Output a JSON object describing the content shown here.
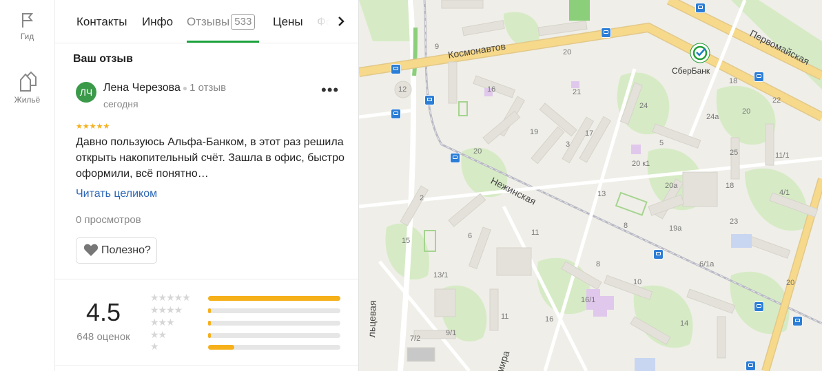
{
  "rail": {
    "items": [
      {
        "label": "Гид",
        "icon": "flag-icon"
      },
      {
        "label": "Жильё",
        "icon": "houses-icon"
      }
    ]
  },
  "tabs": [
    {
      "label": "Контакты"
    },
    {
      "label": "Инфо"
    },
    {
      "label": "Отзывы",
      "badge": "533",
      "active": true
    },
    {
      "label": "Цены"
    },
    {
      "label": "Фо"
    }
  ],
  "review": {
    "section_title": "Ваш отзыв",
    "avatar_initials": "ЛЧ",
    "author": "Лена Черезова",
    "author_reviews": "1 отзыв",
    "date": "сегодня",
    "stars": "★★★★★",
    "text": "Давно пользуюсь Альфа-Банком, в этот раз решила открыть накопительный счёт. Зашла в офис, быстро оформили, всё понятно…",
    "read_more": "Читать целиком",
    "views": "0 просмотров",
    "useful_label": "Полезно?"
  },
  "summary": {
    "rating": "4.5",
    "count": "648 оценок",
    "distribution": [
      {
        "stars": "★★★★★",
        "share": 1.0
      },
      {
        "stars": "★★★★",
        "share": 0.02
      },
      {
        "stars": "★★★",
        "share": 0.02
      },
      {
        "stars": "★★",
        "share": 0.015
      },
      {
        "stars": "★",
        "share": 0.2
      }
    ]
  },
  "map": {
    "streets": [
      "Космонавтов",
      "Первомайская",
      "Нежинская",
      "льцевая",
      "мира"
    ],
    "poi": "СберБанк",
    "colors": {
      "road_major": "#f7d98b",
      "park": "#d6ebc5",
      "building": "#e3e1da",
      "bus_stop": "#2b7dd6",
      "sber_green": "#21a038"
    },
    "house_numbers": [
      "9",
      "12",
      "20",
      "16",
      "21",
      "24",
      "24а",
      "18",
      "20",
      "22",
      "5",
      "19",
      "17",
      "3",
      "20",
      "20 к1",
      "25",
      "11/1",
      "20а",
      "2",
      "18",
      "13",
      "19а",
      "23",
      "4/1",
      "6",
      "11",
      "8",
      "15",
      "6/1а",
      "13/1",
      "8",
      "10",
      "16/1",
      "11",
      "16",
      "14",
      "7/2",
      "9/1",
      "20"
    ]
  }
}
